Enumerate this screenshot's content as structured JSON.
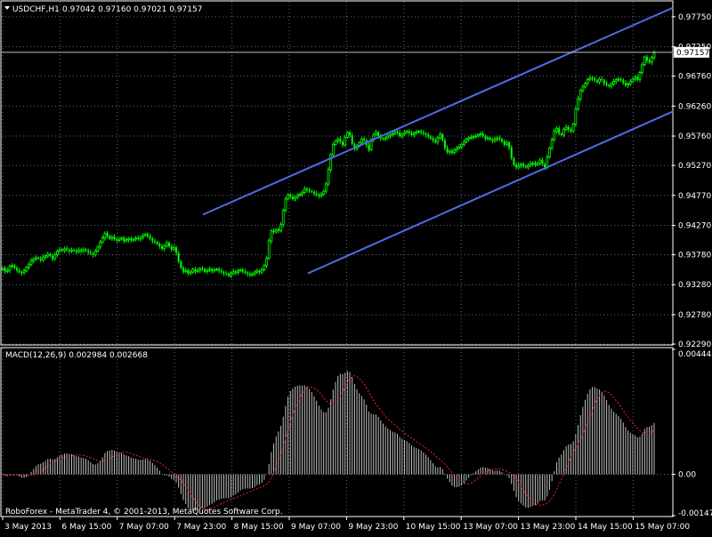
{
  "header": {
    "symbol_label": "USDCHF,H1",
    "ohlc_label": "0.97042 0.97160 0.97021 0.97157"
  },
  "macd_header": {
    "label": "MACD(12,26,9) 0.002984 0.002668"
  },
  "footer": {
    "copyright": "RoboForex - MetaTrader 4, © 2001-2013, MetaQuotes Software Corp."
  },
  "colors": {
    "background": "#000000",
    "frame": "#ffffff",
    "grid": "#5c6a7a",
    "bull": "#00ff00",
    "bear": "#00ff00",
    "channel": "#4f6ce8",
    "price_line": "#c0c0c0",
    "macd_hist": "#c0c0c0",
    "macd_signal": "#ff2020",
    "text": "#ffffff"
  },
  "chart_data": [
    {
      "type": "candlestick",
      "title": "USDCHF,H1",
      "ylim": [
        0.9229,
        0.98
      ],
      "y_ticks": [
        "0.97750",
        "0.97250",
        "0.96760",
        "0.96260",
        "0.95760",
        "0.95270",
        "0.94770",
        "0.94270",
        "0.93780",
        "0.93280",
        "0.92780",
        "0.92290"
      ],
      "x_ticks": [
        "3 May 2013",
        "6 May 15:00",
        "7 May 07:00",
        "7 May 23:00",
        "8 May 15:00",
        "9 May 07:00",
        "9 May 23:00",
        "10 May 15:00",
        "13 May 07:00",
        "13 May 23:00",
        "14 May 15:00",
        "15 May 07:00"
      ],
      "current_price": "0.97157",
      "closes": [
        0.9356,
        0.935,
        0.9352,
        0.9359,
        0.936,
        0.9356,
        0.9352,
        0.9349,
        0.9348,
        0.9351,
        0.9357,
        0.9362,
        0.9368,
        0.9371,
        0.9373,
        0.9372,
        0.9369,
        0.9374,
        0.9376,
        0.9379,
        0.9376,
        0.9371,
        0.9378,
        0.9384,
        0.9387,
        0.9385,
        0.9388,
        0.9386,
        0.9384,
        0.9386,
        0.9385,
        0.9383,
        0.9386,
        0.9384,
        0.9387,
        0.9385,
        0.9382,
        0.938,
        0.9378,
        0.9384,
        0.9391,
        0.9399,
        0.9406,
        0.9414,
        0.9409,
        0.9405,
        0.9408,
        0.9404,
        0.9402,
        0.9404,
        0.9406,
        0.9401,
        0.9403,
        0.9405,
        0.9402,
        0.9404,
        0.9406,
        0.9404,
        0.9407,
        0.941,
        0.9412,
        0.9409,
        0.9405,
        0.9401,
        0.9399,
        0.9396,
        0.9392,
        0.9388,
        0.9393,
        0.9398,
        0.9392,
        0.9387,
        0.939,
        0.9381,
        0.9367,
        0.9356,
        0.935,
        0.9352,
        0.9347,
        0.9349,
        0.9354,
        0.935,
        0.9352,
        0.9355,
        0.9354,
        0.935,
        0.9352,
        0.9354,
        0.9351,
        0.9353,
        0.9354,
        0.9351,
        0.9349,
        0.9347,
        0.9346,
        0.9343,
        0.9347,
        0.935,
        0.9348,
        0.9351,
        0.9353,
        0.935,
        0.9348,
        0.9346,
        0.9344,
        0.9346,
        0.9349,
        0.9351,
        0.9349,
        0.9353,
        0.936,
        0.9372,
        0.9401,
        0.9418,
        0.9416,
        0.942,
        0.9418,
        0.9428,
        0.9452,
        0.9471,
        0.9478,
        0.9475,
        0.9471,
        0.9474,
        0.9477,
        0.9479,
        0.9482,
        0.9488,
        0.9486,
        0.9484,
        0.9483,
        0.948,
        0.9478,
        0.9476,
        0.9479,
        0.9484,
        0.9496,
        0.952,
        0.9545,
        0.9562,
        0.9568,
        0.9571,
        0.9566,
        0.9561,
        0.9574,
        0.9582,
        0.9577,
        0.9563,
        0.9555,
        0.9559,
        0.9565,
        0.9571,
        0.9569,
        0.9561,
        0.9553,
        0.957,
        0.9578,
        0.9582,
        0.9576,
        0.9572,
        0.9571,
        0.9573,
        0.9576,
        0.9578,
        0.958,
        0.9583,
        0.9582,
        0.9576,
        0.9579,
        0.9582,
        0.9584,
        0.9581,
        0.9578,
        0.9581,
        0.9583,
        0.9584,
        0.9582,
        0.958,
        0.9578,
        0.9575,
        0.9572,
        0.9569,
        0.9566,
        0.9573,
        0.9579,
        0.9569,
        0.9556,
        0.9549,
        0.9551,
        0.9548,
        0.9553,
        0.9556,
        0.9558,
        0.9562,
        0.9566,
        0.9571,
        0.9573,
        0.9574,
        0.9575,
        0.9576,
        0.9578,
        0.958,
        0.9576,
        0.9572,
        0.9573,
        0.957,
        0.9568,
        0.9571,
        0.9573,
        0.9571,
        0.9567,
        0.9562,
        0.9565,
        0.9557,
        0.9539,
        0.9528,
        0.9524,
        0.9527,
        0.9529,
        0.9526,
        0.9524,
        0.9527,
        0.953,
        0.9531,
        0.9528,
        0.9531,
        0.9536,
        0.9529,
        0.9524,
        0.9541,
        0.9556,
        0.957,
        0.9584,
        0.9589,
        0.958,
        0.9578,
        0.9587,
        0.9591,
        0.9587,
        0.9584,
        0.9596,
        0.9621,
        0.9638,
        0.9652,
        0.9658,
        0.9664,
        0.967,
        0.9673,
        0.9672,
        0.9669,
        0.9666,
        0.9671,
        0.9669,
        0.9664,
        0.9661,
        0.9659,
        0.9663,
        0.9667,
        0.967,
        0.9671,
        0.9669,
        0.9665,
        0.9661,
        0.9663,
        0.9667,
        0.9671,
        0.9674,
        0.967,
        0.9682,
        0.9695,
        0.9708,
        0.9702,
        0.9699,
        0.9707,
        0.9715
      ]
    },
    {
      "type": "bar",
      "title": "MACD(12,26,9)",
      "ylim": [
        -0.00147,
        0.00448
      ],
      "y_ticks": [
        "0.004448",
        "0.00",
        "-0.00147"
      ]
    }
  ]
}
